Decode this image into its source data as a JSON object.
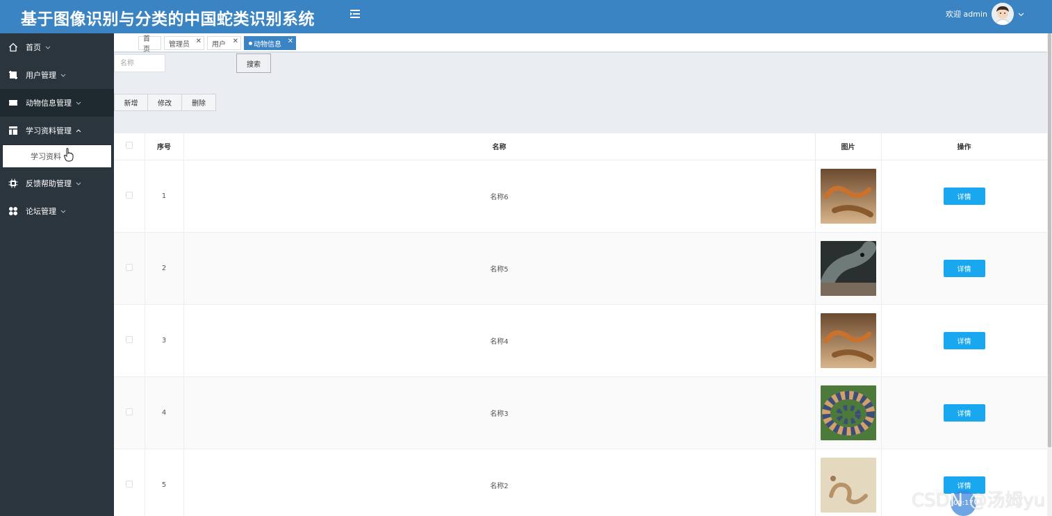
{
  "header": {
    "title": "基于图像识别与分类的中国蛇类识别系统",
    "welcome": "欢迎 admin"
  },
  "sidebar": {
    "items": [
      {
        "label": "首页",
        "icon": "home-icon"
      },
      {
        "label": "用户管理",
        "icon": "crop-icon"
      },
      {
        "label": "动物信息管理",
        "icon": "ticket-icon"
      },
      {
        "label": "学习资料管理",
        "icon": "layout-icon"
      },
      {
        "label": "反馈帮助管理",
        "icon": "chip-icon"
      },
      {
        "label": "论坛管理",
        "icon": "grid-icon"
      }
    ],
    "submenu_label": "学习资料"
  },
  "tabs": [
    {
      "label": "首页"
    },
    {
      "label": "管理员"
    },
    {
      "label": "用户"
    },
    {
      "label": "动物信息"
    }
  ],
  "search": {
    "placeholder": "名称",
    "button": "搜索"
  },
  "actions": {
    "add": "新增",
    "edit": "修改",
    "delete": "删除"
  },
  "table": {
    "headers": {
      "index": "序号",
      "name": "名称",
      "image": "图片",
      "ops": "操作"
    },
    "rows": [
      {
        "index": "1",
        "name": "名称6",
        "image": "brown-snake"
      },
      {
        "index": "2",
        "name": "名称5",
        "image": "grey-snake"
      },
      {
        "index": "3",
        "name": "名称4",
        "image": "brown-snake"
      },
      {
        "index": "4",
        "name": "名称3",
        "image": "banded-snake"
      },
      {
        "index": "5",
        "name": "名称2",
        "image": "sand-snake"
      }
    ],
    "detail_label": "详情"
  },
  "watermark": "CSDN @汤姆yu",
  "timer": "00:17",
  "colors": {
    "header": "#3a84c4",
    "sidebar": "#2b353e",
    "detail_button": "#19a8ef"
  }
}
